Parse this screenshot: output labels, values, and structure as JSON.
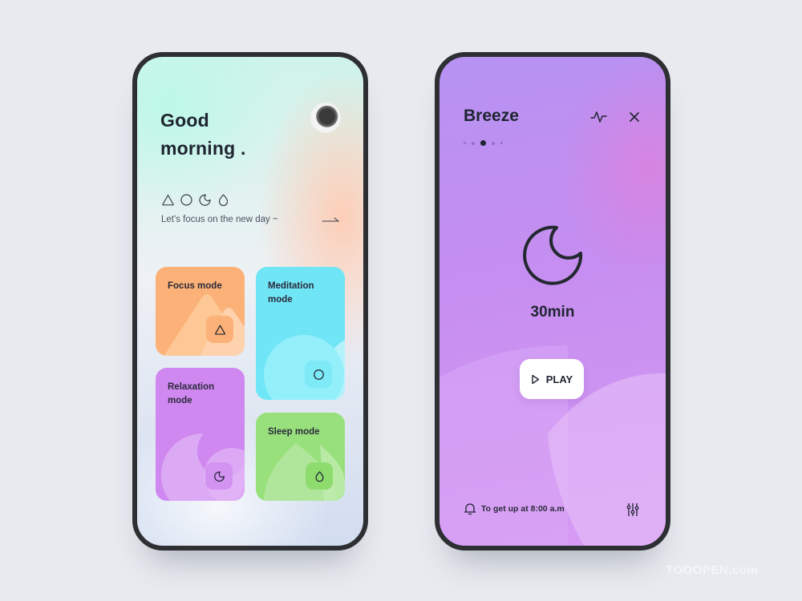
{
  "left_screen": {
    "greeting": "Good\nmorning .",
    "greeting_line1": "Good",
    "greeting_line2": "morning .",
    "mode_icons": [
      "triangle-icon",
      "circle-icon",
      "moon-icon",
      "drop-icon"
    ],
    "tagline": "Let's focus on the new day ~",
    "cards": [
      {
        "label": "Focus mode",
        "icon": "triangle-icon",
        "color": "#fbb177"
      },
      {
        "label": "Meditation mode",
        "icon": "circle-icon",
        "color": "#70e5f6"
      },
      {
        "label": "Relaxation mode",
        "icon": "moon-icon",
        "color": "#cf88f0"
      },
      {
        "label": "Sleep mode",
        "icon": "drop-icon",
        "color": "#98e07c"
      }
    ]
  },
  "right_screen": {
    "title": "Breeze",
    "page_indicator": {
      "count": 5,
      "active": 2
    },
    "duration": "30min",
    "play_label": "PLAY",
    "alarm_text": "To get up at 8:00 a.m",
    "accent": "#c68ef0"
  },
  "watermark": "TOOOPEN.com"
}
